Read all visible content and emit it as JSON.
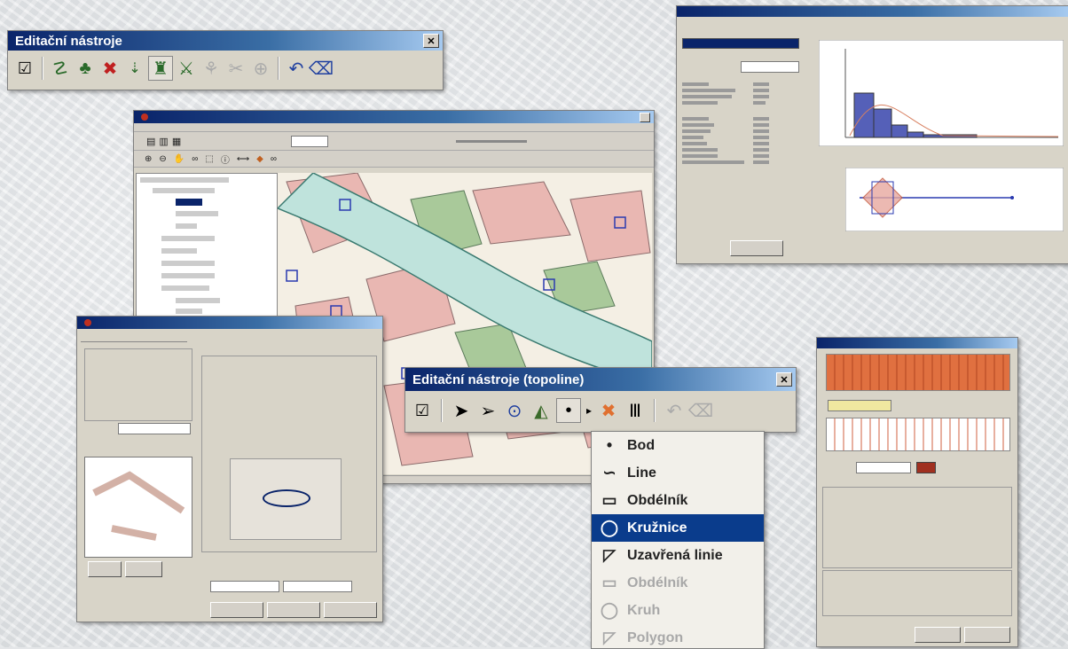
{
  "toolbar1": {
    "title": "Editační nástroje",
    "close": "✕",
    "icons": [
      "checkbox-icon",
      "snap-icon",
      "move-icon",
      "delete-icon",
      "insert-vertex-icon",
      "edit-nodes-icon",
      "split-icon",
      "merge-icon",
      "rotate-icon",
      "target-icon",
      "undo-icon",
      "cancel-edit-icon"
    ]
  },
  "toolbar2": {
    "title": "Editační nástroje (topoline)",
    "close": "✕"
  },
  "dropdown": {
    "items": [
      {
        "label": "Bod",
        "icon": "point-icon",
        "glyph": "•",
        "state": "normal"
      },
      {
        "label": "Line",
        "icon": "line-icon",
        "glyph": "∽",
        "state": "normal"
      },
      {
        "label": "Obdélník",
        "icon": "rectangle-icon",
        "glyph": "▭",
        "state": "normal"
      },
      {
        "label": "Kružnice",
        "icon": "circle-icon",
        "glyph": "◯",
        "state": "selected"
      },
      {
        "label": "Uzavřená linie",
        "icon": "closed-line-icon",
        "glyph": "◸",
        "state": "normal"
      },
      {
        "label": "Obdélník",
        "icon": "rectangle-icon",
        "glyph": "▭",
        "state": "disabled"
      },
      {
        "label": "Kruh",
        "icon": "disc-icon",
        "glyph": "◯",
        "state": "disabled"
      },
      {
        "label": "Polygon",
        "icon": "polygon-icon",
        "glyph": "◸",
        "state": "disabled"
      }
    ]
  },
  "colors": {
    "title_start": "#0a246a",
    "title_end": "#a6caf0",
    "menu_selected": "#0a3c8c",
    "map_water": "#bfe3dc",
    "map_green": "#a9c99a",
    "map_building": "#e9b7b2",
    "histogram_bar": "#5560b8"
  }
}
